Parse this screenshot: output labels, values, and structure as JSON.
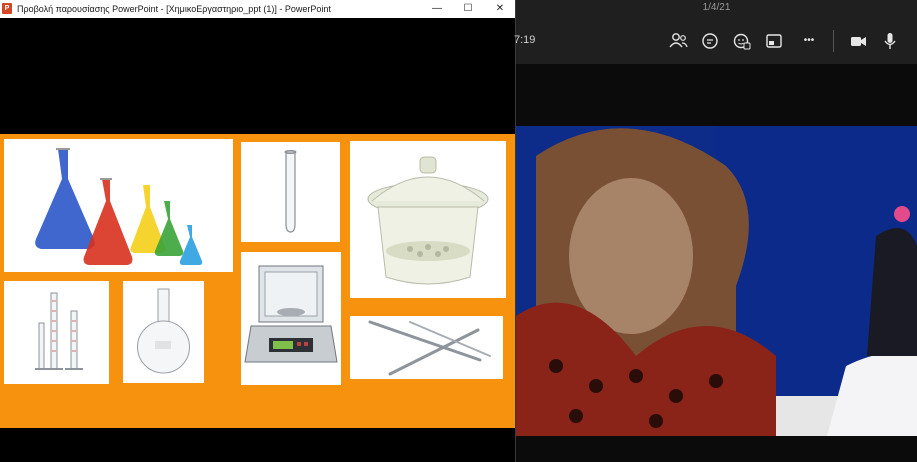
{
  "ppt_window": {
    "app_icon_letter": "P",
    "title": "Προβολή παρουσίασης PowerPoint - [ΧημικοΕργαστηριο_ppt (1)] - PowerPoint",
    "minimize_glyph": "—",
    "maximize_glyph": "☐",
    "close_glyph": "✕",
    "slide_background_color": "#f7920f"
  },
  "teams": {
    "date": "1/4/21",
    "timer": "7:19",
    "more_glyph": "•••"
  }
}
